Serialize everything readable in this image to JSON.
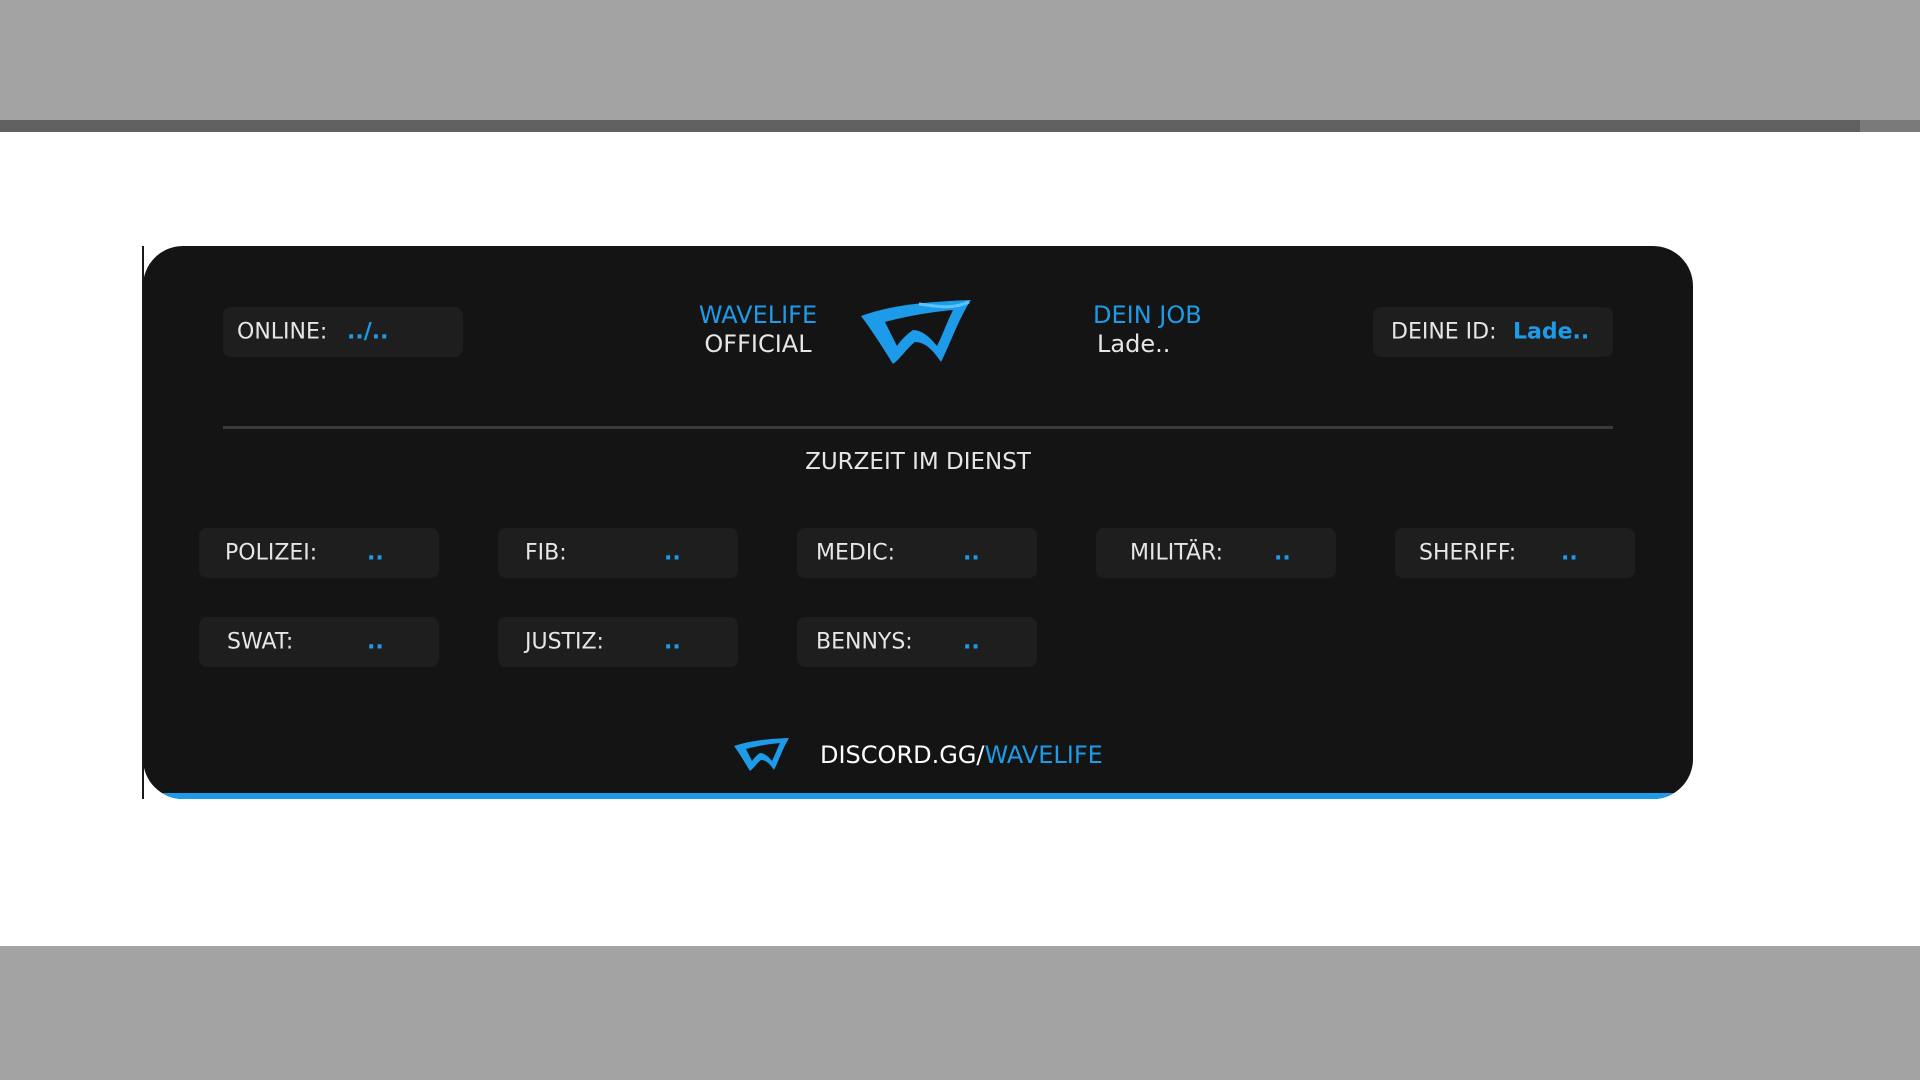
{
  "hud": {
    "online": {
      "label": "ONLINE:",
      "value": "../.."
    },
    "brand": {
      "line1": "WAVELIFE",
      "line2": "OFFICIAL"
    },
    "job": {
      "label": "DEIN JOB",
      "value": "Lade.."
    },
    "id": {
      "label": "DEINE ID:",
      "value": "Lade.."
    },
    "section_title": "ZURZEIT IM DIENST",
    "services": [
      {
        "label": "POLIZEI:",
        "value": ".."
      },
      {
        "label": "FIB:",
        "value": ".."
      },
      {
        "label": "MEDIC:",
        "value": ".."
      },
      {
        "label": "MILITÄR:",
        "value": ".."
      },
      {
        "label": "SHERIFF:",
        "value": ".."
      },
      {
        "label": "SWAT:",
        "value": ".."
      },
      {
        "label": "JUSTIZ:",
        "value": ".."
      },
      {
        "label": "BENNYS:",
        "value": ".."
      }
    ],
    "footer": {
      "prefix": "DISCORD.GG/",
      "accent": "WAVELIFE"
    }
  },
  "icons": {
    "logo": "wavelife-logo-icon"
  },
  "colors": {
    "accent": "#1d9be8",
    "panel_bg": "#141414",
    "pill_bg": "#1e1e1e",
    "text": "#e6e6e6"
  }
}
